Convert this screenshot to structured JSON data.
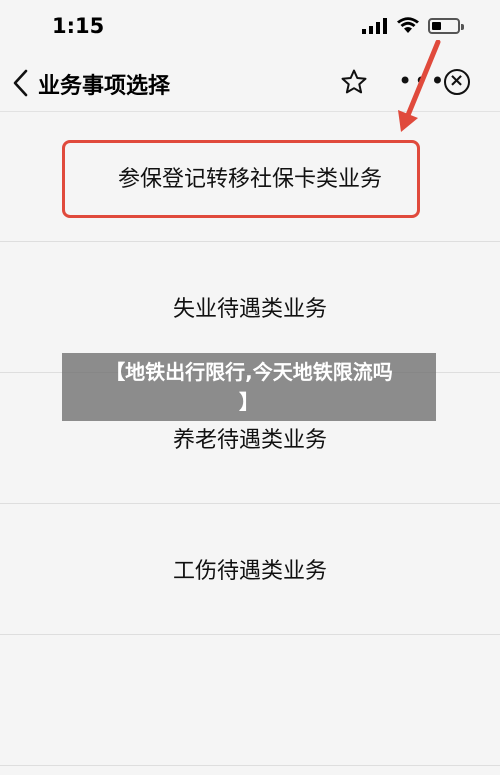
{
  "status": {
    "time": "1:15"
  },
  "nav": {
    "title": "业务事项选择",
    "more_label": "•••",
    "close_label": "×"
  },
  "list": {
    "items": [
      {
        "label": "参保登记转移社保卡类业务"
      },
      {
        "label": "失业待遇类业务"
      },
      {
        "label": "养老待遇类业务"
      },
      {
        "label": "工伤待遇类业务"
      },
      {
        "label": ""
      }
    ]
  },
  "overlay": {
    "line1": "【地铁出行限行,今天地铁限流吗",
    "line2": "】"
  },
  "colors": {
    "annotation": "#e04a3c",
    "background": "#f5f5f5",
    "overlay": "#6e6e6e"
  },
  "icons": [
    "cellular-signal-icon",
    "wifi-icon",
    "battery-icon",
    "back-chevron-icon",
    "star-icon",
    "more-dots-icon",
    "close-circle-icon",
    "annotation-arrow-icon"
  ]
}
